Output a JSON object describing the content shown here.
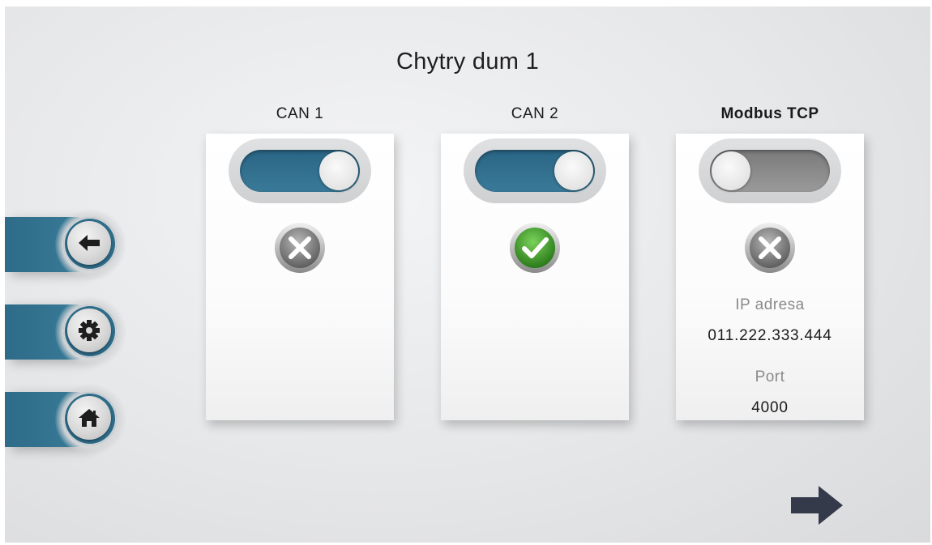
{
  "header": {
    "title": "Chytry dum 1"
  },
  "nav": [
    {
      "name": "back",
      "icon": "arrow-left-icon"
    },
    {
      "name": "settings",
      "icon": "gear-icon"
    },
    {
      "name": "home",
      "icon": "home-icon"
    }
  ],
  "cards": [
    {
      "label": "CAN 1",
      "toggle": "on",
      "status": "error",
      "status_icon": "x-circle-icon"
    },
    {
      "label": "CAN 2",
      "toggle": "on",
      "status": "ok",
      "status_icon": "check-circle-icon"
    },
    {
      "label": "Modbus TCP",
      "toggle": "off",
      "status": "error",
      "status_icon": "x-circle-icon",
      "ip_label": "IP adresa",
      "ip_value": "011.222.333.444",
      "port_label": "Port",
      "port_value": "4000"
    }
  ],
  "footer": {
    "next_icon": "arrow-right-icon"
  },
  "colors": {
    "accent": "#2f6d8a",
    "ok": "#3a9a2a",
    "toggle_off": "#8a8a8a",
    "dark_arrow": "#343a4a"
  }
}
